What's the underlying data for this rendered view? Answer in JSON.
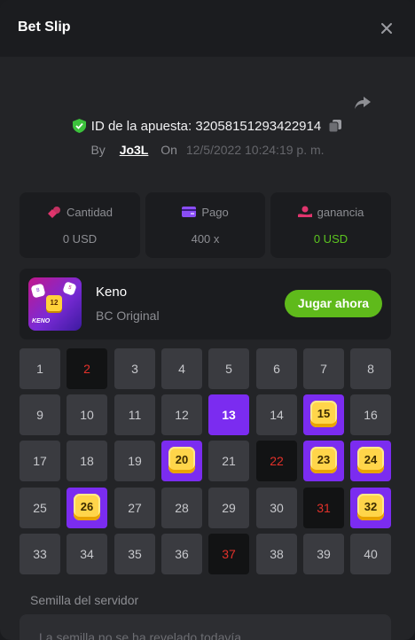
{
  "header": {
    "title": "Bet Slip",
    "close_icon": "close-icon"
  },
  "bet": {
    "id_label": "ID de la apuesta:",
    "id_value": "32058151293422914",
    "by_label": "By",
    "user": "Jo3L",
    "on_label": "On",
    "date": "12/5/2022 10:24:19 p. m."
  },
  "stats": [
    {
      "label": "Cantidad",
      "value": "0 USD",
      "icon": "coins-icon",
      "icon_color": "#e0356d"
    },
    {
      "label": "Pago",
      "value": "400 x",
      "icon": "card-icon",
      "icon_color": "#8a4df5"
    },
    {
      "label": "ganancia",
      "value": "0 USD",
      "icon": "hand-money-icon",
      "icon_color": "#e0356d",
      "value_color": "#5cc520"
    }
  ],
  "game": {
    "name": "Keno",
    "subtitle": "BC Original",
    "play_label": "Jugar ahora",
    "thumb_text": "KENO",
    "thumb_dice": [
      "8",
      "12",
      "5"
    ]
  },
  "keno": {
    "numbers": [
      "1",
      "2",
      "3",
      "4",
      "5",
      "6",
      "7",
      "8",
      "9",
      "10",
      "11",
      "12",
      "13",
      "14",
      "15",
      "16",
      "17",
      "18",
      "19",
      "20",
      "21",
      "22",
      "23",
      "24",
      "25",
      "26",
      "27",
      "28",
      "29",
      "30",
      "31",
      "32",
      "33",
      "34",
      "35",
      "36",
      "37",
      "38",
      "39",
      "40"
    ],
    "states": [
      "n",
      "miss",
      "n",
      "n",
      "n",
      "n",
      "n",
      "n",
      "n",
      "n",
      "n",
      "n",
      "sel",
      "n",
      "hit",
      "n",
      "n",
      "n",
      "n",
      "hit",
      "n",
      "miss",
      "hit",
      "hit",
      "n",
      "hit",
      "n",
      "n",
      "n",
      "n",
      "miss",
      "hit",
      "n",
      "n",
      "n",
      "n",
      "miss",
      "n",
      "n",
      "n"
    ]
  },
  "seed": {
    "label": "Semilla del servidor",
    "placeholder": "La semilla no se ha revelado todavía"
  },
  "colors": {
    "accent_purple": "#7b2cf0",
    "play_green": "#5fba1b",
    "miss_red": "#e3312a",
    "gem_yellow": "#ffd54a"
  }
}
